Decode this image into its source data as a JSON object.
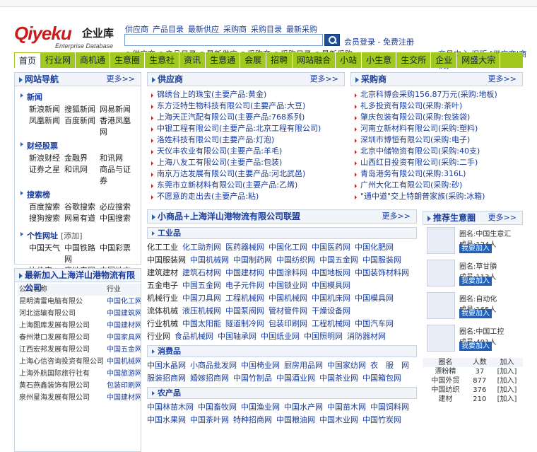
{
  "logo": {
    "brand": "Qiyeku",
    "cn": "企业库",
    "en": "Enterprise Database"
  },
  "search": {
    "tabs": [
      "供应商",
      "产品目录",
      "最新供应",
      "采购商",
      "采购目录",
      "最新采购"
    ],
    "placeholder": "",
    "register": "会员登录 - 免费注册"
  },
  "radios": [
    {
      "label": "供应商",
      "on": true
    },
    {
      "label": "产品目录",
      "on": false
    },
    {
      "label": "最新供应",
      "on": false
    },
    {
      "label": "采购商",
      "on": false
    },
    {
      "label": "采购目录",
      "on": false
    },
    {
      "label": "最新采购",
      "on": false
    }
  ],
  "toplinks": "交易中心 旧版:[供应商|商机]",
  "nav": [
    "首页",
    "行业网",
    "商机通",
    "生意圈",
    "生意社",
    "资讯",
    "生意通",
    "会展",
    "招聘",
    "网站融合",
    "小站",
    "小生意",
    "生交所",
    "企业",
    "网盛大宗"
  ],
  "left": {
    "title": "网站导航",
    "more": "更多>>",
    "groups": [
      {
        "name": "新闻",
        "links": [
          [
            "新浪新闻",
            "搜狐新闻",
            "网易新闻"
          ],
          [
            "凤凰新闻",
            "百度新闻",
            "香港凤凰网"
          ]
        ]
      },
      {
        "name": "财经股票",
        "links": [
          [
            "新浪财经",
            "金融界",
            "和讯网"
          ],
          [
            "证券之星",
            "和讯网",
            "商品与证券"
          ]
        ]
      },
      {
        "name": "搜索榜",
        "links": [
          [
            "百度搜索",
            "谷歌搜索",
            "必应搜索"
          ],
          [
            "搜狗搜索",
            "网易有道",
            "中国搜索"
          ]
        ]
      }
    ],
    "personal": {
      "name": "个性网址",
      "note": "[添加]",
      "links": [
        "中国天气",
        "中国铁路网",
        "中国彩票",
        "比价宝",
        "房地产网",
        "中国地方"
      ]
    }
  },
  "latest": {
    "title": "最新加入上海洋山港物流有限公司",
    "head": [
      "公司名称",
      "行业"
    ],
    "rows": [
      [
        "昆明清雷电脑有限公",
        "中国化工网"
      ],
      [
        "河北运输有限公司",
        "中国建筑网"
      ],
      [
        "上海图库发展有限公司",
        "中国建材网"
      ],
      [
        "春州港口发展有限公司",
        "中国家具网"
      ],
      [
        "江西宏邦发展有限公司",
        "中国五金网"
      ],
      [
        "上海心信咨询投资有限公司",
        "中国机械网"
      ],
      [
        "上海外航国际旅行社有",
        "中国旅游网"
      ],
      [
        "黄石燕鑫装饰有限公司",
        "包装印刷网"
      ],
      [
        "泉州星海发展有限公司",
        "中国建材网"
      ]
    ]
  },
  "supply": {
    "title": "供应商",
    "more": "更多>>",
    "items": [
      "锦绣台上的珠宝(主要产品:黄金)",
      "东方泛特生物科技有限公司(主要产品:大豆)",
      "上海天正汽配有限公司(主要产品:768系列)",
      "中银工程有限公司(主要产品:北京工程有限公司)",
      "洛姓科技有限公司(主要产品:灯泡)",
      "天仪丰农业有限公司(主要产品:羊毛)",
      "上海八友工有限公司(主要产品:包装)",
      "南京万达发展有限公司(主要产品:河北武邑)",
      "东莞市立新材料有限公司(主要产品:乙烯)",
      "不愿意的走出去(主要产品:粘)"
    ]
  },
  "buy": {
    "title": "采购商",
    "more": "更多>>",
    "items": [
      "北京科博会采购156.87万元(采购:地板)",
      "礼多投资有限公司(采购:茶叶)",
      "肇庆包装有限公司(采购:包装袋)",
      "河南立新材料有限公司(采购:塑料)",
      "深圳市博恒有限公司(采购:电子)",
      "北京中储物资有限公司(采购:40支)",
      "山西红日投资有限公司(采购:二手)",
      "青岛港务有限公司(采购:316L)",
      "广州大化工有限公司(采购:砂)",
      "\"通中道\"交上特朗普家族(采购:冰箱)"
    ]
  },
  "industry": {
    "title": "小商品+上海洋山港物流有限公司联盟",
    "more": "更多>>",
    "cats": [
      {
        "name": "工业品",
        "rows": [
          [
            "化工工业",
            "化工助剂网",
            "医药器械网",
            "中国化工网",
            "中国医药网",
            "中国化肥网"
          ],
          [
            "中国服装网",
            "中国机械网",
            "中国制药网",
            "中国纺织网",
            "中国五金网",
            "中国服装网"
          ],
          [
            "建筑建材",
            "建筑石材网",
            "中国建材网",
            "中国涂料网",
            "中国地板网",
            "中国装饰材料网"
          ],
          [
            "五金电子",
            "中国五金网",
            "电子元件网",
            "中国锁业网",
            "中国模具网"
          ],
          [
            "机械行业",
            "中国刀具网",
            "工程机械网",
            "中国机械网",
            "中国机床网",
            "中国模具网"
          ],
          [
            "流体机械",
            "液压机械网",
            "中国泵阀网",
            "管材管件网",
            "干燥设备网"
          ],
          [
            "行业机械",
            "中国太阳能",
            "隧道制冷网",
            "包装印刷网",
            "工程机械网",
            "中国汽车网"
          ],
          [
            "行业网",
            "食品机械网",
            "中国轴承网",
            "中国纸业网",
            "中国照明网",
            "消防器材网"
          ]
        ]
      },
      {
        "name": "消费品",
        "rows": [
          [
            "中国水晶网",
            "小商品批发网",
            "中国椅业网",
            "厨房用品网",
            "中国家纺网",
            "衣　服　网"
          ],
          [
            "服装招商网",
            "婚嫁招商网",
            "中国竹制品",
            "中国酒业网",
            "中国茶业网",
            "中国箱包网"
          ]
        ]
      },
      {
        "name": "农产品",
        "rows": [
          [
            "中国林苗木网",
            "中国畜牧网",
            "中国渔业网",
            "中国水产网",
            "中国苗木网",
            "中国饲料网"
          ],
          [
            "中国水果网",
            "中国茶叶网",
            "特种招商网",
            "中国粮油网",
            "中国木业网",
            "中国竹炭网"
          ]
        ]
      }
    ]
  },
  "recommend": {
    "title": "推荐生意圈",
    "more": "更多>>",
    "items": [
      {
        "name": "圈名:中国生意汇",
        "count": "成员:124人",
        "btn": "我要加入"
      },
      {
        "name": "圈名:草甘膦",
        "count": "成员:113人",
        "btn": "我要加入"
      },
      {
        "name": "圈名:自动化",
        "count": "成员:165人",
        "btn": "我要加入"
      },
      {
        "name": "圈名:中国工控",
        "count": "成员:491人",
        "btn": "我要加入"
      }
    ],
    "table": {
      "head": [
        "圈名",
        "人数",
        "加入"
      ],
      "rows": [
        [
          "漂粉精",
          "37",
          "[加入]"
        ],
        [
          "中国外贸",
          "877",
          "[加入]"
        ],
        [
          "中国纺织",
          "376",
          "[加入]"
        ],
        [
          "建材",
          "210",
          "[加入]"
        ]
      ]
    }
  }
}
